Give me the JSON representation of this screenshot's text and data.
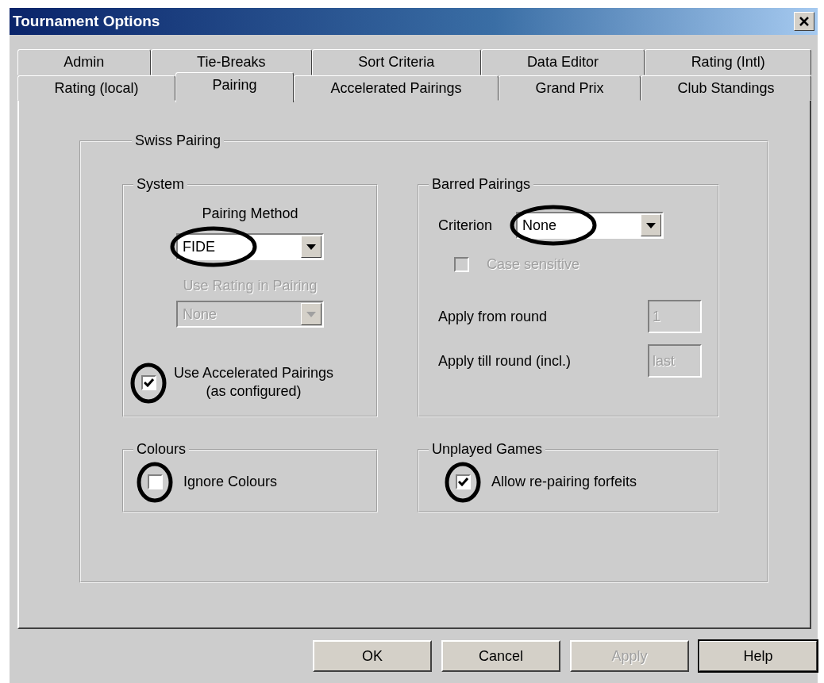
{
  "window": {
    "title": "Tournament Options"
  },
  "tab_rows": [
    [
      {
        "label": "Admin",
        "selected": false
      },
      {
        "label": "Tie-Breaks",
        "selected": false
      },
      {
        "label": "Sort Criteria",
        "selected": false
      },
      {
        "label": "Data Editor",
        "selected": false
      },
      {
        "label": "Rating (Intl)",
        "selected": false
      }
    ],
    [
      {
        "label": "Rating (local)",
        "selected": false
      },
      {
        "label": "Pairing",
        "selected": true
      },
      {
        "label": "Accelerated Pairings",
        "selected": false
      },
      {
        "label": "Grand Prix",
        "selected": false
      },
      {
        "label": "Club Standings",
        "selected": false
      }
    ]
  ],
  "swiss_pairing": {
    "title": "Swiss Pairing",
    "system": {
      "title": "System",
      "pairing_method": {
        "label": "Pairing Method",
        "value": "FIDE",
        "disabled": false,
        "circled": true
      },
      "use_rating": {
        "label": "Use Rating in Pairing",
        "value": "None",
        "disabled": true
      },
      "accelerated": {
        "label": "Use Accelerated Pairings",
        "note": "(as configured)",
        "checked": true,
        "disabled": false,
        "circled": true
      }
    },
    "barred_pairings": {
      "title": "Barred Pairings",
      "criterion": {
        "label": "Criterion",
        "value": "None",
        "disabled": false,
        "circled": true
      },
      "case_sensitive": {
        "label": "Case sensitive",
        "checked": false,
        "disabled": true
      },
      "apply_from": {
        "label": "Apply from round",
        "value": "1",
        "disabled": true
      },
      "apply_till": {
        "label": "Apply till round (incl.)",
        "value": "last",
        "disabled": true
      }
    },
    "colours": {
      "title": "Colours",
      "ignore_colours": {
        "label": "Ignore Colours",
        "checked": false,
        "disabled": false,
        "circled": true
      }
    },
    "unplayed_games": {
      "title": "Unplayed Games",
      "allow_repairing": {
        "label": "Allow re-pairing forfeits",
        "checked": true,
        "disabled": false,
        "circled": true
      }
    }
  },
  "buttons": [
    {
      "label": "OK",
      "disabled": false,
      "default": false
    },
    {
      "label": "Cancel",
      "disabled": false,
      "default": false
    },
    {
      "label": "Apply",
      "disabled": true,
      "default": false
    },
    {
      "label": "Help",
      "disabled": false,
      "default": true
    }
  ]
}
